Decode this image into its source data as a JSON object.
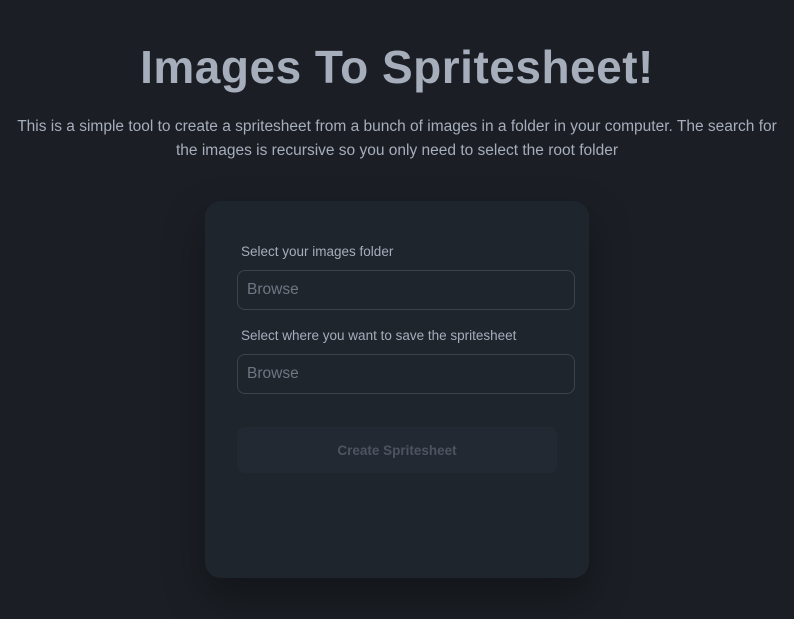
{
  "header": {
    "title": "Images To Spritesheet!",
    "description": "This is a simple tool to create a spritesheet from a bunch of images in a folder in your computer. The search for the images is recursive so you only need to select the root folder"
  },
  "form": {
    "source": {
      "label": "Select your images folder",
      "placeholder": "Browse",
      "value": ""
    },
    "destination": {
      "label": "Select where you want to save the spritesheet",
      "placeholder": "Browse",
      "value": ""
    },
    "submit_label": "Create Spritesheet",
    "submit_disabled": true
  },
  "colors": {
    "background": "#1b1f25",
    "card": "#1f252d",
    "text": "#a6adbb",
    "button_disabled": "#232932"
  }
}
